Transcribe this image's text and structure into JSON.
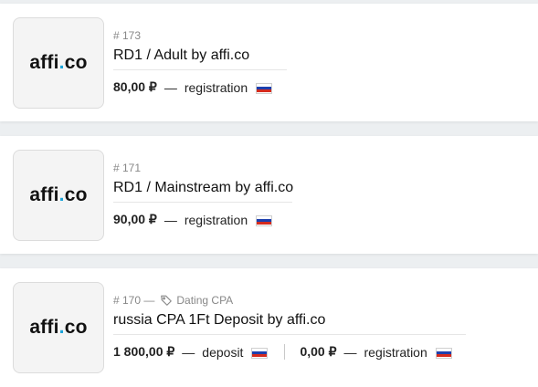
{
  "offers": [
    {
      "logo": {
        "text_main": "affi",
        "text_dot": ".",
        "text_tail": "co"
      },
      "number": "# 173",
      "title": "RD1 / Adult by affi.co",
      "payouts": [
        {
          "amount": "80,00 ₽",
          "dash": "—",
          "type": "registration",
          "flag": "ru-flag-icon"
        }
      ]
    },
    {
      "logo": {
        "text_main": "affi",
        "text_dot": ".",
        "text_tail": "co"
      },
      "number": "# 171",
      "title": "RD1 / Mainstream by affi.co",
      "payouts": [
        {
          "amount": "90,00 ₽",
          "dash": "—",
          "type": "registration",
          "flag": "ru-flag-icon"
        }
      ]
    },
    {
      "logo": {
        "text_main": "affi",
        "text_dot": ".",
        "text_tail": "co"
      },
      "number": "# 170 —",
      "tag": {
        "icon": "tag-icon",
        "label": "Dating CPA"
      },
      "title": "russia CPA 1Ft Deposit by affi.co",
      "payouts": [
        {
          "amount": "1 800,00 ₽",
          "dash": "—",
          "type": "deposit",
          "flag": "ru-flag-icon"
        },
        {
          "amount": "0,00 ₽",
          "dash": "—",
          "type": "registration",
          "flag": "ru-flag-icon"
        }
      ]
    }
  ],
  "colors": {
    "logo_dot": "#1aa3d9",
    "flag_white": "#ffffff",
    "flag_blue": "#1c3fae",
    "flag_red": "#d52b1e"
  }
}
